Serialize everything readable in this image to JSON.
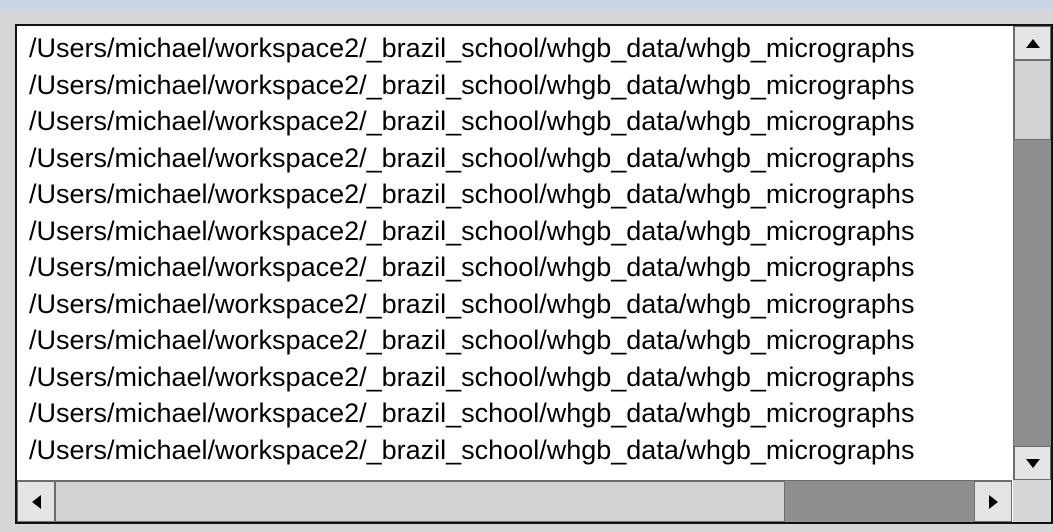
{
  "listbox": {
    "items": [
      "/Users/michael/workspace2/_brazil_school/whgb_data/whgb_micrographs",
      "/Users/michael/workspace2/_brazil_school/whgb_data/whgb_micrographs",
      "/Users/michael/workspace2/_brazil_school/whgb_data/whgb_micrographs",
      "/Users/michael/workspace2/_brazil_school/whgb_data/whgb_micrographs",
      "/Users/michael/workspace2/_brazil_school/whgb_data/whgb_micrographs",
      "/Users/michael/workspace2/_brazil_school/whgb_data/whgb_micrographs",
      "/Users/michael/workspace2/_brazil_school/whgb_data/whgb_micrographs",
      "/Users/michael/workspace2/_brazil_school/whgb_data/whgb_micrographs",
      "/Users/michael/workspace2/_brazil_school/whgb_data/whgb_micrographs",
      "/Users/michael/workspace2/_brazil_school/whgb_data/whgb_micrographs",
      "/Users/michael/workspace2/_brazil_school/whgb_data/whgb_micrographs",
      "/Users/michael/workspace2/_brazil_school/whgb_data/whgb_micrographs"
    ]
  },
  "scrollbars": {
    "vertical": {
      "up_icon": "triangle-up-icon",
      "down_icon": "triangle-down-icon",
      "position": 0.0
    },
    "horizontal": {
      "left_icon": "triangle-left-icon",
      "right_icon": "triangle-right-icon",
      "position": 0.0
    }
  },
  "colors": {
    "background": "#c9d6e6",
    "panel": "#d6d6d6",
    "list_background": "#ffffff",
    "scroll_track": "#8e8e8e",
    "scroll_thumb": "#d2d2d2"
  }
}
